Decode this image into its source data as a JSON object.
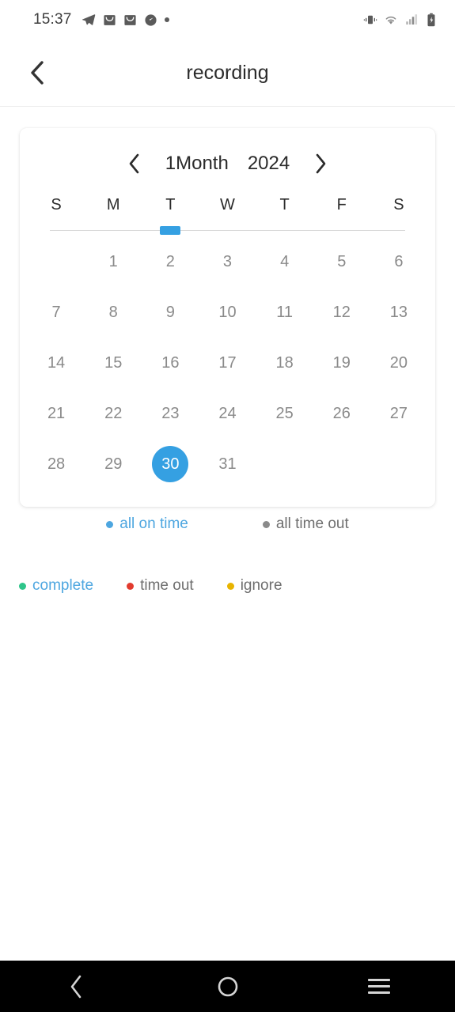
{
  "status_bar": {
    "time": "15:37",
    "left_icons": [
      "telegram-icon",
      "mail-icon",
      "mail-icon",
      "clock-icon",
      "dot-icon"
    ],
    "right_icons": [
      "vibrate-icon",
      "wifi-icon",
      "signal-icon",
      "battery-charging-icon"
    ]
  },
  "app_bar": {
    "back_icon": "chevron-left-icon",
    "title": "recording"
  },
  "calendar": {
    "prev_icon": "chevron-left-icon",
    "next_icon": "chevron-right-icon",
    "month_label": "1Month",
    "year_label": "2024",
    "weekdays": [
      "S",
      "M",
      "T",
      "W",
      "T",
      "F",
      "S"
    ],
    "indicator_column": 2,
    "selected_day": "30",
    "accent_color": "#35a0e2",
    "rows": [
      [
        "",
        "1",
        "2",
        "3",
        "4",
        "5",
        "6"
      ],
      [
        "7",
        "8",
        "9",
        "10",
        "11",
        "12",
        "13"
      ],
      [
        "14",
        "15",
        "16",
        "17",
        "18",
        "19",
        "20"
      ],
      [
        "21",
        "22",
        "23",
        "24",
        "25",
        "26",
        "27"
      ],
      [
        "28",
        "29",
        "30",
        "31",
        "",
        "",
        ""
      ]
    ]
  },
  "legend_primary": [
    {
      "label": "all on time",
      "dot_color": "#4da6e0",
      "text_color": "#4da6e0"
    },
    {
      "label": "all time out",
      "dot_color": "#8a8a8a",
      "text_color": "#6e6e6e"
    }
  ],
  "legend_secondary": [
    {
      "label": "complete",
      "dot_color": "#2ec58a",
      "text_color": "#4da6e0"
    },
    {
      "label": "time out",
      "dot_color": "#e23b2e",
      "text_color": "#6e6e6e"
    },
    {
      "label": "ignore",
      "dot_color": "#e8b400",
      "text_color": "#6e6e6e"
    }
  ],
  "nav_bar": {
    "back_icon": "chevron-left-icon",
    "home_icon": "circle-icon",
    "recents_icon": "hamburger-icon"
  }
}
